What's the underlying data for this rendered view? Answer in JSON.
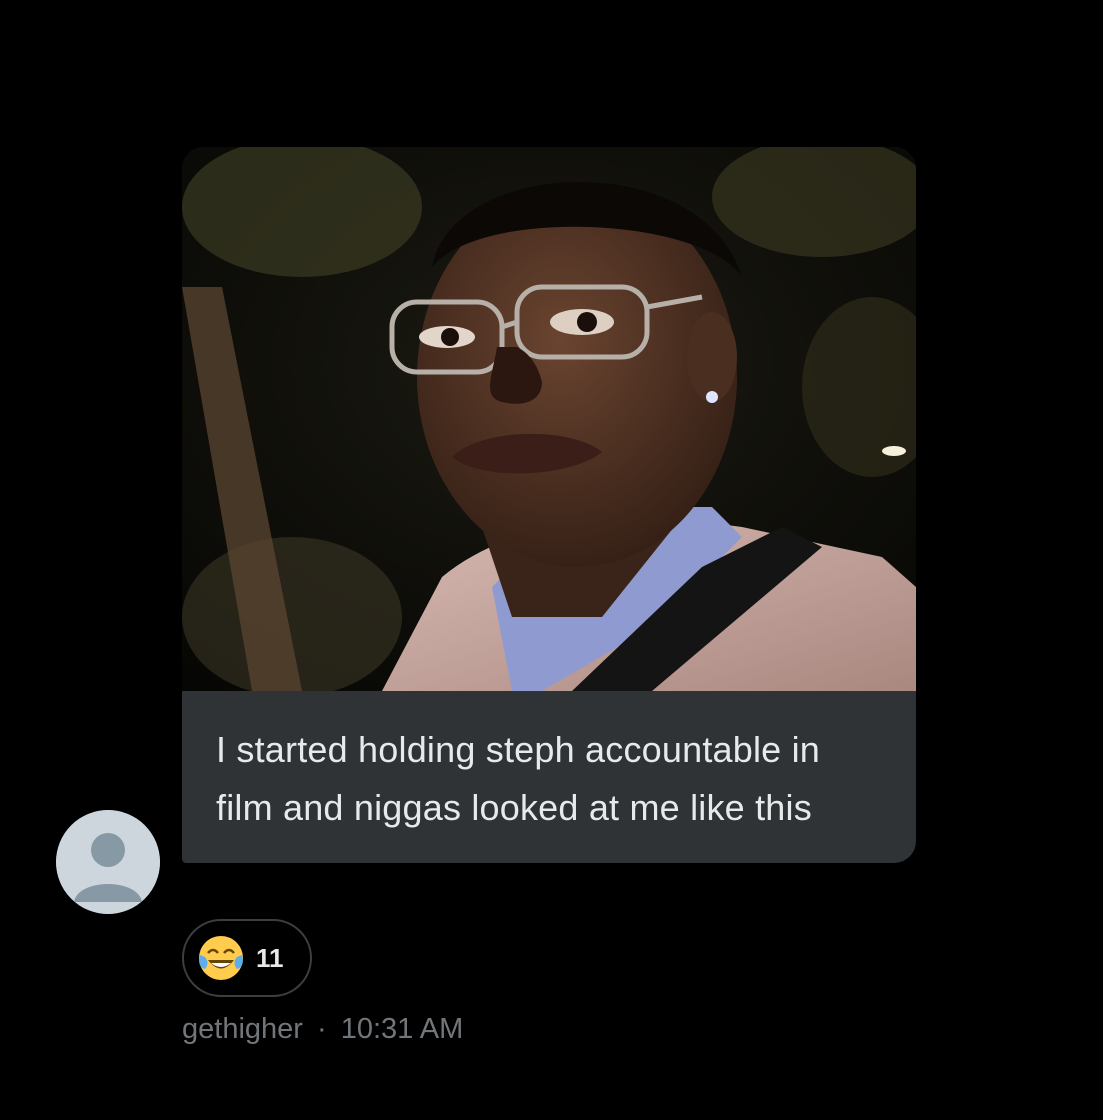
{
  "message": {
    "text": "I started holding steph accountable in film and niggas looked at me like this",
    "media": {
      "type": "photo",
      "icon": "meme-photo"
    }
  },
  "reaction": {
    "emoji_icon": "face-with-tears-of-joy-icon",
    "count": "11"
  },
  "meta": {
    "username": "gethigher",
    "separator": "·",
    "time": "10:31 AM"
  },
  "avatar": {
    "icon": "default-user-avatar-icon"
  },
  "colors": {
    "background": "#000000",
    "bubble": "#2f3336",
    "text": "#e7e9ea",
    "meta": "#71767b",
    "avatar_bg": "#cdd5dd",
    "avatar_fg": "#8899a6"
  }
}
